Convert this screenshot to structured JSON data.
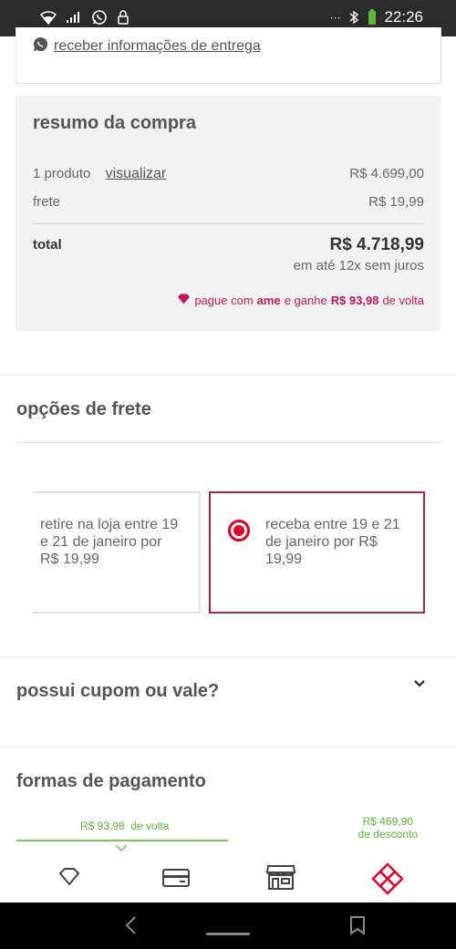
{
  "status_bar": {
    "time": "22:26",
    "more": "···"
  },
  "delivery_info": {
    "whatsapp_link": "receber informações de entrega"
  },
  "summary": {
    "title": "resumo da compra",
    "products_label": "1 produto",
    "view_link": "visualizar",
    "products_value": "R$ 4.699,00",
    "shipping_label": "frete",
    "shipping_value": "R$ 19,99",
    "total_label": "total",
    "total_value": "R$ 4.718,99",
    "installments": "em até 12x sem juros",
    "ame_prefix": "pague com",
    "ame_brand": "ame",
    "ame_middle": "e ganhe",
    "ame_amount": "R$ 93,98",
    "ame_suffix": "de volta"
  },
  "shipping_options": {
    "title": "opções de frete",
    "options": [
      {
        "label": "retire na loja entre 19 e 21 de janeiro por R$ 19,99",
        "selected": false
      },
      {
        "label": "receba entre 19 e 21 de janeiro por R$ 19,99",
        "selected": true
      }
    ]
  },
  "coupon": {
    "title": "possui cupom ou vale?"
  },
  "payment": {
    "title": "formas de pagamento",
    "cashback_amount": "R$ 93,98",
    "cashback_suffix": "de volta",
    "discount_amount": "R$ 469,90",
    "discount_suffix": "de desconto",
    "tabs": [
      {
        "icon": "ame-diamond-icon"
      },
      {
        "icon": "credit-card-icon"
      },
      {
        "icon": "store-icon"
      },
      {
        "icon": "boleto-icon"
      }
    ]
  },
  "colors": {
    "accent_red": "#e0002a",
    "ame_pink": "#c2185b",
    "green": "#5ab738"
  }
}
